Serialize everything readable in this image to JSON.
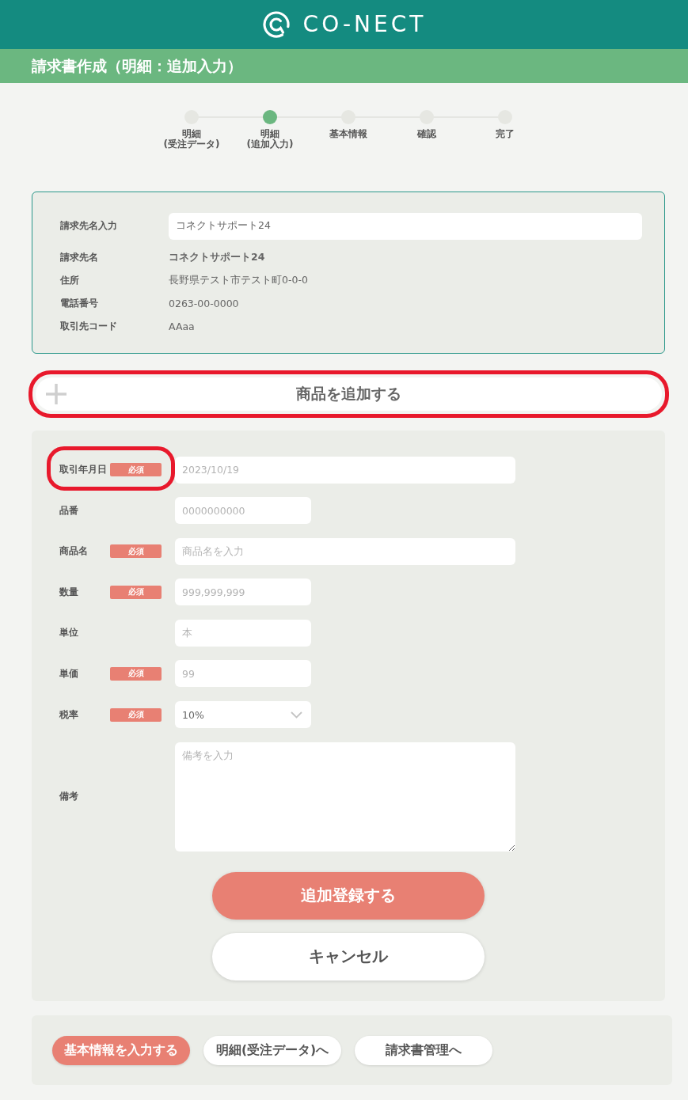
{
  "header": {
    "logo_text": "CO-NECT"
  },
  "title_bar": {
    "title": "請求書作成（明細：追加入力）"
  },
  "steps": [
    {
      "label": "明細\n(受注データ)",
      "selected": false
    },
    {
      "label": "明細\n(追加入力)",
      "selected": true
    },
    {
      "label": "基本情報",
      "selected": false
    },
    {
      "label": "確認",
      "selected": false
    },
    {
      "label": "完了",
      "selected": false
    }
  ],
  "client": {
    "search": {
      "label": "請求先名入力",
      "value": "コネクトサポート24"
    },
    "details": [
      {
        "label": "請求先名",
        "value": "コネクトサポート24",
        "emphasized": true
      },
      {
        "label": "住所",
        "value": "長野県テスト市テスト町0-0-0",
        "emphasized": false
      },
      {
        "label": "電話番号",
        "value": "0263-00-0000",
        "emphasized": false
      },
      {
        "label": "取引先コード",
        "value": "AAaa",
        "emphasized": false
      }
    ]
  },
  "add_item_button": {
    "label": "商品を追加する",
    "highlighted": true
  },
  "item_form": {
    "fields": [
      {
        "kind": "date",
        "label": "取引年月日",
        "required": true,
        "badge": "必須",
        "placeholder": "2023/10/19",
        "highlighted": true
      },
      {
        "kind": "code",
        "label": "品番",
        "required": false,
        "placeholder": "0000000000",
        "highlighted": false
      },
      {
        "kind": "text",
        "label": "商品名",
        "required": true,
        "badge": "必須",
        "placeholder": "商品名を入力",
        "highlighted": false
      },
      {
        "kind": "number",
        "label": "数量",
        "required": true,
        "badge": "必須",
        "placeholder": "999,999,999",
        "highlighted": false
      },
      {
        "kind": "unit",
        "label": "単位",
        "required": false,
        "placeholder": "本",
        "highlighted": false
      },
      {
        "kind": "price",
        "label": "単価",
        "required": true,
        "badge": "必須",
        "placeholder": "99",
        "highlighted": false
      },
      {
        "kind": "select",
        "label": "税率",
        "required": true,
        "badge": "必須",
        "value": "10%",
        "highlighted": false
      },
      {
        "kind": "textarea",
        "label": "備考",
        "required": false,
        "placeholder": "備考を入力",
        "highlighted": false
      }
    ],
    "actions": [
      {
        "kind": "primary",
        "label": "追加登録する"
      },
      {
        "kind": "secondary",
        "label": "キャンセル"
      }
    ]
  },
  "footer_nav": [
    {
      "kind": "primary",
      "label": "基本情報を入力する"
    },
    {
      "kind": "secondary",
      "label": "明細(受注データ)へ"
    },
    {
      "kind": "secondary",
      "label": "請求書管理へ"
    }
  ]
}
